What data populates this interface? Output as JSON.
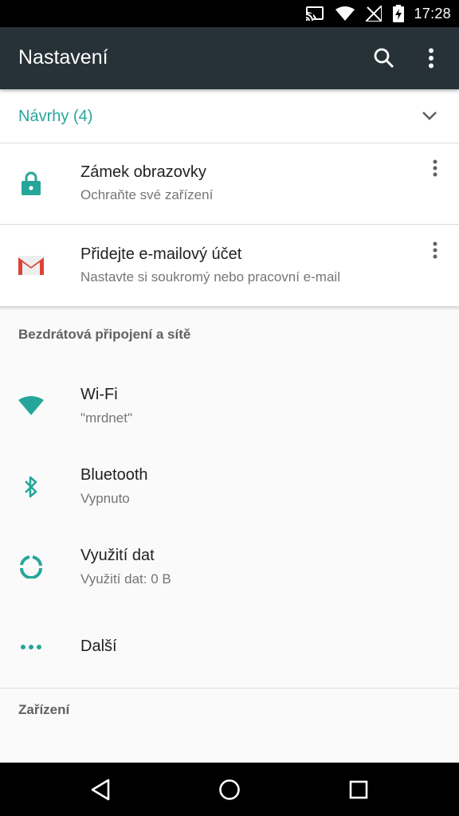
{
  "status_bar": {
    "time": "17:28",
    "icons": [
      "cast-icon",
      "wifi-icon",
      "no-signal-icon",
      "battery-charging-icon"
    ]
  },
  "app_bar": {
    "title": "Nastavení",
    "actions": [
      "search-icon",
      "more-vert-icon"
    ]
  },
  "suggestions": {
    "title": "Návrhy (4)",
    "cards": [
      {
        "icon": "lock-icon",
        "title": "Zámek obrazovky",
        "subtitle": "Ochraňte své zařízení"
      },
      {
        "icon": "gmail-icon",
        "title": "Přidejte e-mailový účet",
        "subtitle": "Nastavte si soukromý nebo pracovní e-mail"
      }
    ]
  },
  "sections": [
    {
      "header": "Bezdrátová připojení a sítě",
      "items": [
        {
          "icon": "wifi-icon",
          "title": "Wi-Fi",
          "subtitle": "\"mrdnet\""
        },
        {
          "icon": "bluetooth-icon",
          "title": "Bluetooth",
          "subtitle": "Vypnuto"
        },
        {
          "icon": "data-usage-icon",
          "title": "Využití dat",
          "subtitle": "Využití dat: 0 B"
        },
        {
          "icon": "more-horiz-icon",
          "title": "Další"
        }
      ]
    },
    {
      "header": "Zařízení"
    }
  ],
  "nav_bar": [
    "back-icon",
    "home-icon",
    "recents-icon"
  ],
  "colors": {
    "accent": "#26a69a",
    "app_bar": "#263238",
    "status_bar": "#000000",
    "gmail_red": "#db4437"
  }
}
